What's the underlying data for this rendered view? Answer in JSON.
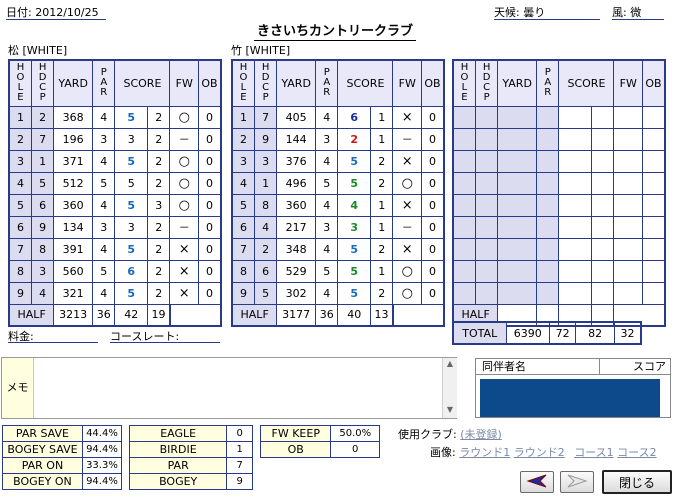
{
  "header": {
    "date_label": "日付:",
    "date_value": "2012/10/25",
    "weather_label": "天候:",
    "weather_value": "曇り",
    "wind_label": "風:",
    "wind_value": "微",
    "title": "きさいちカントリークラブ"
  },
  "columns": {
    "hole": "HOLE",
    "hdcp": "HDCP",
    "yard": "YARD",
    "par": "PAR",
    "score": "SCORE",
    "fw": "FW",
    "ob": "OB"
  },
  "out": {
    "course": "松 [WHITE]",
    "rows": [
      {
        "hole": "1",
        "hdcp": "2",
        "yard": "368",
        "par": "4",
        "score": "5",
        "putt": "2",
        "fw": "○",
        "ob": "0"
      },
      {
        "hole": "2",
        "hdcp": "7",
        "yard": "196",
        "par": "3",
        "score": "3",
        "putt": "2",
        "fw": "－",
        "ob": "0"
      },
      {
        "hole": "3",
        "hdcp": "1",
        "yard": "371",
        "par": "4",
        "score": "5",
        "putt": "2",
        "fw": "○",
        "ob": "0"
      },
      {
        "hole": "4",
        "hdcp": "5",
        "yard": "512",
        "par": "5",
        "score": "5",
        "putt": "2",
        "fw": "○",
        "ob": "0"
      },
      {
        "hole": "5",
        "hdcp": "6",
        "yard": "360",
        "par": "4",
        "score": "5",
        "putt": "3",
        "fw": "○",
        "ob": "0"
      },
      {
        "hole": "6",
        "hdcp": "9",
        "yard": "134",
        "par": "3",
        "score": "3",
        "putt": "2",
        "fw": "－",
        "ob": "0"
      },
      {
        "hole": "7",
        "hdcp": "8",
        "yard": "391",
        "par": "4",
        "score": "5",
        "putt": "2",
        "fw": "×",
        "ob": "0"
      },
      {
        "hole": "8",
        "hdcp": "3",
        "yard": "560",
        "par": "5",
        "score": "6",
        "putt": "2",
        "fw": "×",
        "ob": "0"
      },
      {
        "hole": "9",
        "hdcp": "4",
        "yard": "321",
        "par": "4",
        "score": "5",
        "putt": "2",
        "fw": "×",
        "ob": "0"
      }
    ],
    "half": {
      "label": "HALF",
      "yard": "3213",
      "par": "36",
      "score": "42",
      "putt": "19"
    }
  },
  "in": {
    "course": "竹 [WHITE]",
    "rows": [
      {
        "hole": "1",
        "hdcp": "7",
        "yard": "405",
        "par": "4",
        "score": "6",
        "putt": "1",
        "fw": "×",
        "ob": "0"
      },
      {
        "hole": "2",
        "hdcp": "9",
        "yard": "144",
        "par": "3",
        "score": "2",
        "putt": "1",
        "fw": "－",
        "ob": "0"
      },
      {
        "hole": "3",
        "hdcp": "3",
        "yard": "376",
        "par": "4",
        "score": "5",
        "putt": "2",
        "fw": "×",
        "ob": "0"
      },
      {
        "hole": "4",
        "hdcp": "1",
        "yard": "496",
        "par": "5",
        "score": "5",
        "putt": "2",
        "fw": "○",
        "ob": "0"
      },
      {
        "hole": "5",
        "hdcp": "8",
        "yard": "360",
        "par": "4",
        "score": "4",
        "putt": "1",
        "fw": "×",
        "ob": "0"
      },
      {
        "hole": "6",
        "hdcp": "4",
        "yard": "217",
        "par": "3",
        "score": "3",
        "putt": "1",
        "fw": "－",
        "ob": "0"
      },
      {
        "hole": "7",
        "hdcp": "2",
        "yard": "348",
        "par": "4",
        "score": "5",
        "putt": "2",
        "fw": "×",
        "ob": "0"
      },
      {
        "hole": "8",
        "hdcp": "6",
        "yard": "529",
        "par": "5",
        "score": "5",
        "putt": "1",
        "fw": "○",
        "ob": "0"
      },
      {
        "hole": "9",
        "hdcp": "5",
        "yard": "302",
        "par": "4",
        "score": "5",
        "putt": "2",
        "fw": "○",
        "ob": "0"
      }
    ],
    "half": {
      "label": "HALF",
      "yard": "3177",
      "par": "36",
      "score": "40",
      "putt": "13"
    }
  },
  "third": {
    "half_label": "HALF"
  },
  "total": {
    "label": "TOTAL",
    "yard": "6390",
    "par": "72",
    "score": "82",
    "putt": "32"
  },
  "fee_label": "料金:",
  "rate_label": "コースレート:",
  "memo_label": "メモ",
  "companions": {
    "name_label": "同伴者名",
    "score_label": "スコア"
  },
  "stats1": [
    {
      "k": "PAR SAVE",
      "v": "44.4%"
    },
    {
      "k": "BOGEY SAVE",
      "v": "94.4%"
    },
    {
      "k": "PAR ON",
      "v": "33.3%"
    },
    {
      "k": "BOGEY ON",
      "v": "94.4%"
    }
  ],
  "stats2": [
    {
      "k": "EAGLE",
      "v": "0"
    },
    {
      "k": "BIRDIE",
      "v": "1"
    },
    {
      "k": "PAR",
      "v": "7"
    },
    {
      "k": "BOGEY",
      "v": "9"
    }
  ],
  "stats3": [
    {
      "k": "FW KEEP",
      "v": "50.0%"
    },
    {
      "k": "OB",
      "v": "0"
    }
  ],
  "club_label": "使用クラブ:",
  "club_value": "(未登録)",
  "image_label": "画像:",
  "image_links": [
    "ラウンド1",
    "ラウンド2",
    "コース1",
    "コース2"
  ],
  "close_label": "閉じる",
  "colors": {
    "grid": "#2a3a8a",
    "score_par": "#1a6ab8",
    "score_birdie": "#d01818",
    "score_double": "#1a2a9a",
    "score_under": "#1a8a2a",
    "companion_panel": "#0d4a8c"
  }
}
